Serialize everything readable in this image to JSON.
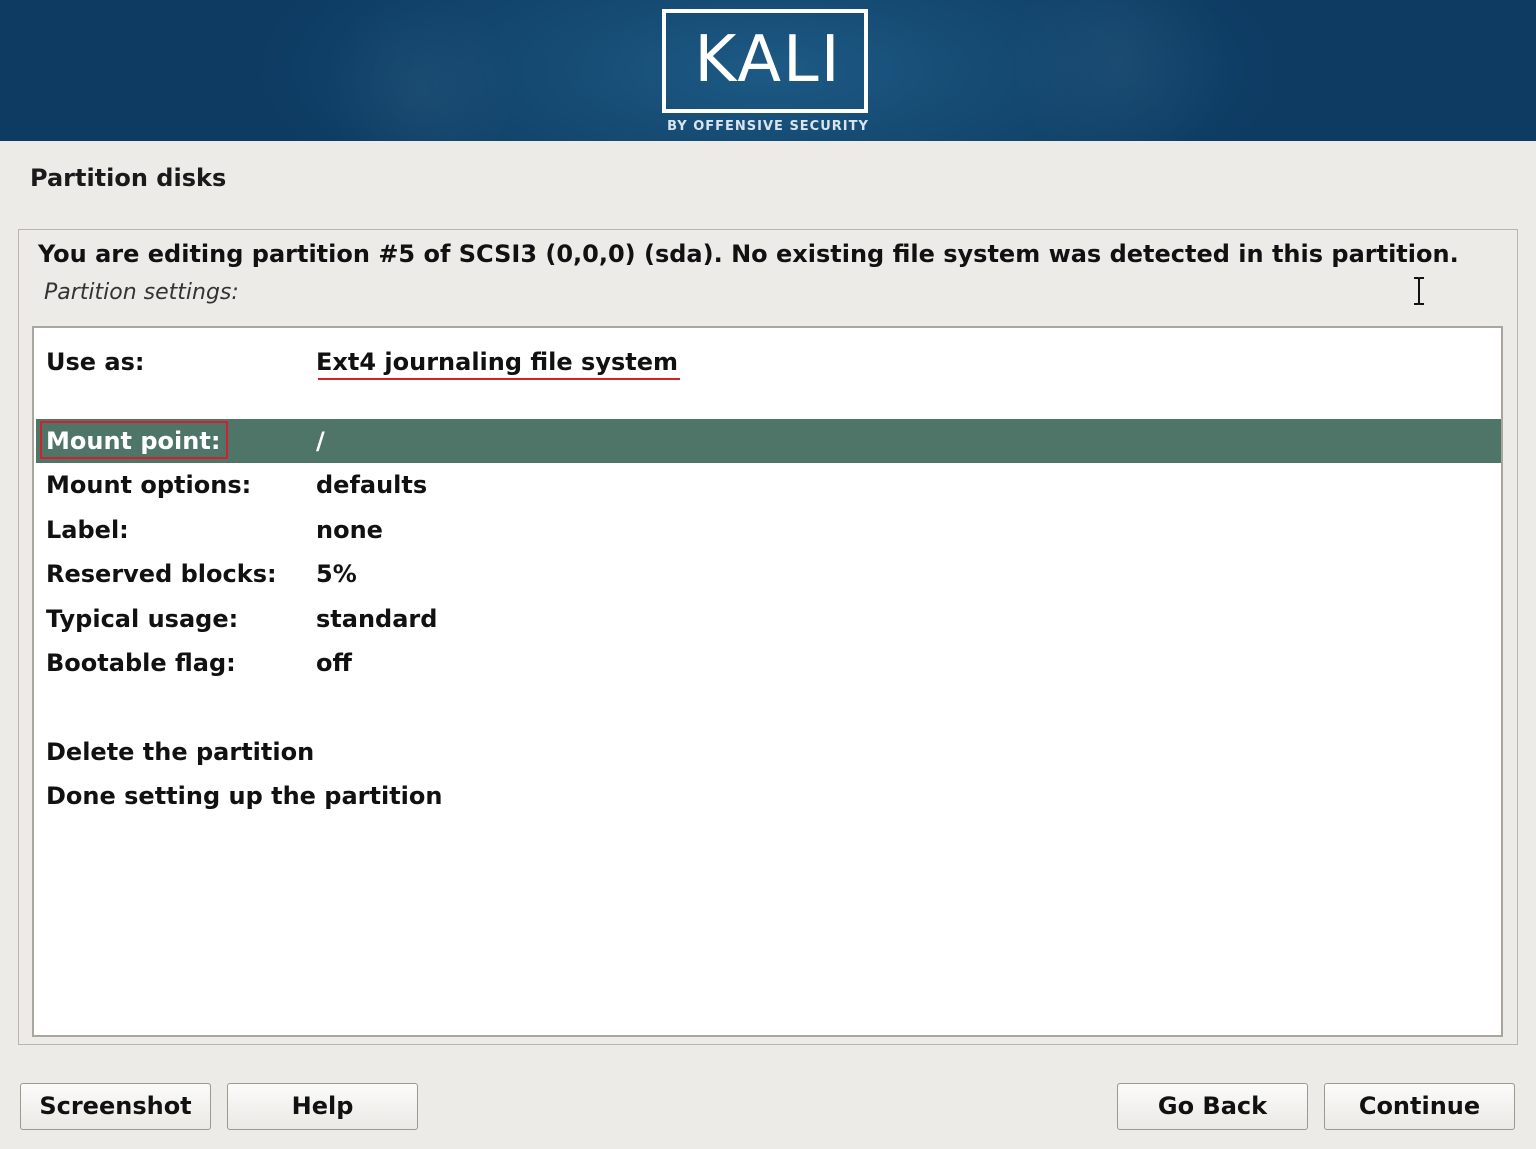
{
  "header": {
    "logo_text": "KALI",
    "logo_subtitle": "BY OFFENSIVE SECURITY"
  },
  "page": {
    "title": "Partition disks",
    "description": "You are editing partition #5 of SCSI3 (0,0,0) (sda). No existing file system was detected in this partition.",
    "subheading": "Partition settings:"
  },
  "settings": {
    "use_as": {
      "label": "Use as:",
      "value": "Ext4 journaling file system"
    },
    "mount_point": {
      "label": "Mount point:",
      "value": "/"
    },
    "mount_options": {
      "label": "Mount options:",
      "value": "defaults"
    },
    "label": {
      "label": "Label:",
      "value": "none"
    },
    "reserved_blocks": {
      "label": "Reserved blocks:",
      "value": "5%"
    },
    "typical_usage": {
      "label": "Typical usage:",
      "value": "standard"
    },
    "bootable_flag": {
      "label": "Bootable flag:",
      "value": "off"
    }
  },
  "actions": {
    "delete": "Delete the partition",
    "done": "Done setting up the partition"
  },
  "buttons": {
    "screenshot": "Screenshot",
    "help": "Help",
    "go_back": "Go Back",
    "continue": "Continue"
  },
  "selected_row": "mount_point",
  "colors": {
    "banner": "#154a72",
    "selection": "#4f7468",
    "annotation": "#d2202c",
    "background": "#edebe7"
  },
  "icons": {
    "cursor": "text-cursor-icon"
  }
}
